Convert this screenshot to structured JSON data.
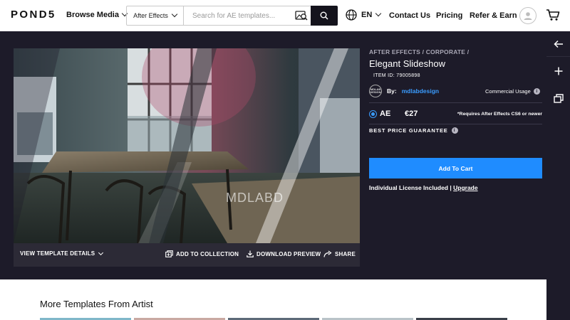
{
  "header": {
    "logo": "POND5",
    "browse_label": "Browse Media",
    "search": {
      "type_label": "After Effects",
      "placeholder": "Search for AE templates...",
      "value": ""
    },
    "language": "EN",
    "nav": [
      "Contact Us",
      "Pricing",
      "Refer & Earn"
    ]
  },
  "preview": {
    "watermark": "MDLABD",
    "actions": {
      "details": "VIEW TEMPLATE DETAILS",
      "collection": "ADD TO COLLECTION",
      "download": "DOWNLOAD PREVIEW",
      "share": "SHARE"
    }
  },
  "product": {
    "breadcrumbs": [
      "AFTER EFFECTS",
      "CORPORATE"
    ],
    "title": "Elegant Slideshow",
    "item_id": "ITEM ID: 79005898",
    "by_label": "By:",
    "artist": "mdlabdesign",
    "artist_logo": "MDLAB DESIGN",
    "commercial_label": "Commercial Usage",
    "format": "AE",
    "price": "€27",
    "requirement": "*Requires After Effects CS6 or newer",
    "guarantee": "BEST PRICE GUARANTEE",
    "add_to_cart": "Add To Cart",
    "license_note": "Individual License Included",
    "upgrade": "Upgrade"
  },
  "more": {
    "heading": "More Templates From Artist"
  },
  "colors": {
    "dark_bg": "#1d1b29",
    "accent_blue": "#1f8cff",
    "link_blue": "#3a9cff"
  }
}
